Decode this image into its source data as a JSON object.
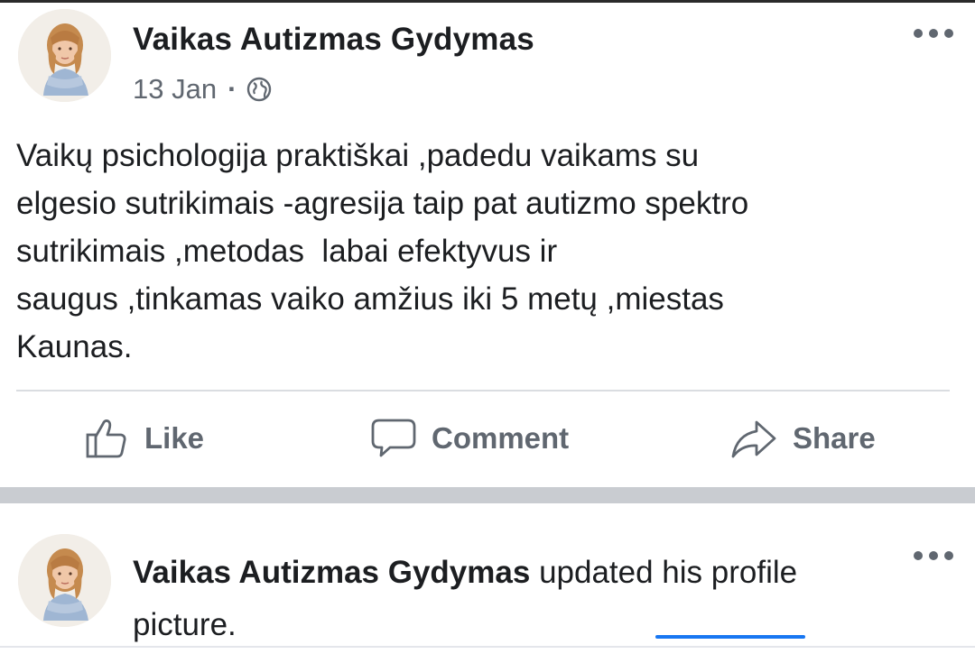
{
  "post": {
    "author": "Vaikas Autizmas Gydymas",
    "date": "13 Jan",
    "separator": "·",
    "privacy_icon": "globe-icon",
    "text": "Vaikų psichologija praktiškai ,padedu vaikams su\nelgesio sutrikimais -agresija taip pat autizmo spektro\nsutrikimais ,metodas  labai efektyvus ir\nsaugus ,tinkamas vaiko amžius iki 5 metų ,miestas\nKaunas.",
    "more_icon": "more-options-icon",
    "actions": {
      "like": "Like",
      "comment": "Comment",
      "share": "Share"
    }
  },
  "update": {
    "author": "Vaikas Autizmas Gydymas",
    "text": "updated his profile picture.",
    "more_icon": "more-options-icon"
  },
  "colors": {
    "text": "#1c1e21",
    "secondary": "#606770",
    "separator": "#c9ccd1",
    "accent": "#1877f2"
  }
}
